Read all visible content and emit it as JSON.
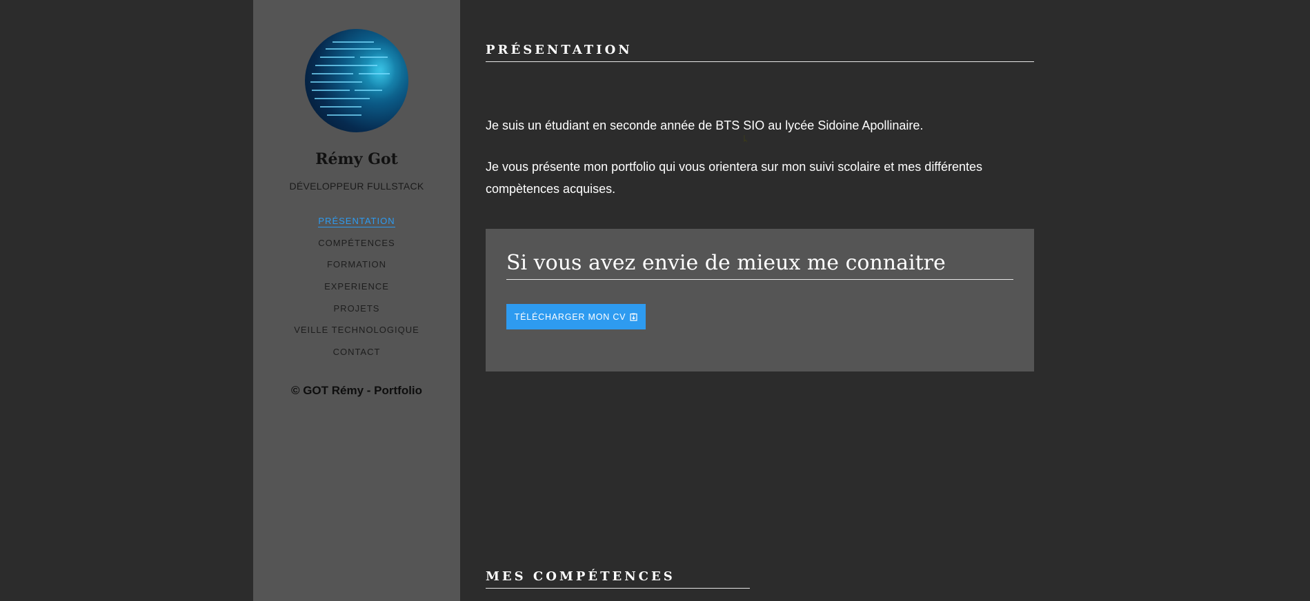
{
  "sidebar": {
    "name": "Rémy Got",
    "role": "DÉVELOPPEUR FULLSTACK",
    "nav": [
      {
        "label": "PRÉSENTATION",
        "active": true
      },
      {
        "label": "COMPÉTENCES",
        "active": false
      },
      {
        "label": "FORMATION",
        "active": false
      },
      {
        "label": "EXPERIENCE",
        "active": false
      },
      {
        "label": "PROJETS",
        "active": false
      },
      {
        "label": "VEILLE TECHNOLOGIQUE",
        "active": false
      },
      {
        "label": "CONTACT",
        "active": false
      }
    ],
    "copyright": "© GOT Rémy - Portfolio"
  },
  "main": {
    "presentation_heading": "PRÉSENTATION",
    "paragraph_1": "Je suis un étudiant en seconde année de BTS SIO au lycée Sidoine Apollinaire.",
    "paragraph_2": "Je vous présente mon portfolio qui vous orientera sur mon suivi scolaire et mes différentes compètences acquises.",
    "cv_box": {
      "title": "Si vous avez envie de mieux me connaitre",
      "button_label": "TÉLÉCHARGER MON CV",
      "button_icon": "download-file-icon"
    },
    "competences_heading": "MES COMPÉTENCES"
  },
  "colors": {
    "background": "#2c2c2c",
    "sidebar": "#555555",
    "accent": "#2e9bf0",
    "text_light": "#ffffff",
    "text_dark": "#111111"
  }
}
